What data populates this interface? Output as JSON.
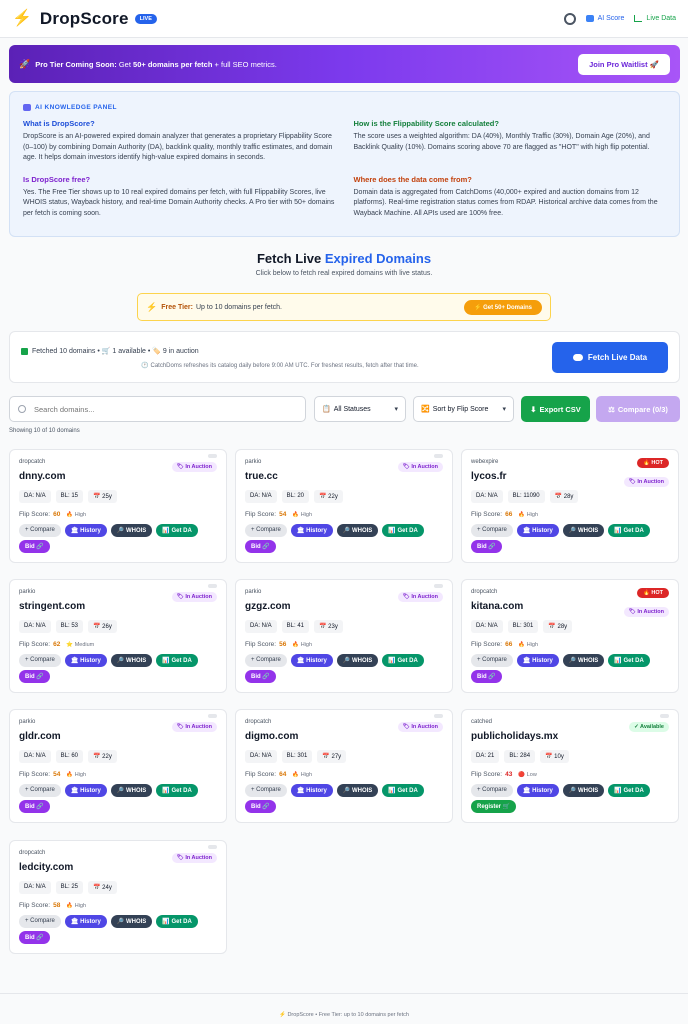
{
  "header": {
    "logo": "DropScore",
    "live_badge": "LIVE",
    "ai_score": "AI Score",
    "live_data": "Live Data"
  },
  "promo": {
    "title": "Pro Tier Coming Soon:",
    "text_pre": "Get",
    "text_bold": "50+ domains per fetch",
    "text_post": "+ full SEO metrics.",
    "button": "Join Pro Waitlist 🚀"
  },
  "knowledge": {
    "title": "AI KNOWLEDGE PANEL",
    "q1": "What is DropScore?",
    "a1": "DropScore is an AI-powered expired domain analyzer that generates a proprietary Flippability Score (0–100) by combining Domain Authority (DA), backlink quality, monthly traffic estimates, and domain age. It helps domain investors identify high-value expired domains in seconds.",
    "q2": "How is the Flippability Score calculated?",
    "a2": "The score uses a weighted algorithm: DA (40%), Monthly Traffic (30%), Domain Age (20%), and Backlink Quality (10%). Domains scoring above 70 are flagged as \"HOT\" with high flip potential.",
    "q3": "Is DropScore free?",
    "a3": "Yes. The Free Tier shows up to 10 real expired domains per fetch, with full Flippability Scores, live WHOIS status, Wayback history, and real-time Domain Authority checks. A Pro tier with 50+ domains per fetch is coming soon.",
    "q4": "Where does the data come from?",
    "a4": "Domain data is aggregated from CatchDoms (40,000+ expired and auction domains from 12 platforms). Real-time registration status comes from RDAP. Historical archive data comes from the Wayback Machine. All APIs used are 100% free."
  },
  "fetch": {
    "title_main": "Fetch Live",
    "title_accent": "Expired Domains",
    "subtitle": "Click below to fetch real expired domains with live status.",
    "free_label": "Free Tier:",
    "free_text": "Up to 10 domains per fetch.",
    "free_btn": "⚡ Get 50+ Domains",
    "stats": "Fetched 10 domains • 🛒 1 available • 🏷️ 9 in auction",
    "note": "🕐 CatchDoms refreshes its catalog daily before 9:00 AM UTC. For freshest results, fetch after that time.",
    "button": "Fetch Live Data"
  },
  "controls": {
    "search_placeholder": "Search domains...",
    "status_select": "All Statuses",
    "sort_select": "Sort by Flip Score",
    "export": "Export CSV",
    "compare": "Compare (0/3)",
    "showing": "Showing 10 of 10 domains"
  },
  "labels": {
    "compare": "+ Compare",
    "history": "History",
    "whois": "🔎 WHOIS",
    "get_da": "Get DA",
    "bid": "Bid 🔗",
    "register": "Register 🛒",
    "flip": "Flip Score:",
    "hot": "🔥 HOT"
  },
  "domains": [
    {
      "registrar": "dropcatch",
      "name": "dnny.com",
      "status": "In Auction",
      "da": "DA: N/A",
      "bl": "BL: 15",
      "age": "25y",
      "score": "60",
      "level": "High"
    },
    {
      "registrar": "parkio",
      "name": "true.cc",
      "status": "In Auction",
      "da": "DA: N/A",
      "bl": "BL: 20",
      "age": "22y",
      "score": "54",
      "level": "High"
    },
    {
      "registrar": "webexpire",
      "name": "lycos.fr",
      "status": "In Auction",
      "da": "DA: N/A",
      "bl": "BL: 11090",
      "age": "28y",
      "score": "66",
      "level": "High"
    },
    {
      "registrar": "parkio",
      "name": "stringent.com",
      "status": "In Auction",
      "da": "DA: N/A",
      "bl": "BL: 53",
      "age": "26y",
      "score": "62",
      "level": "Medium"
    },
    {
      "registrar": "parkio",
      "name": "gzgz.com",
      "status": "In Auction",
      "da": "DA: N/A",
      "bl": "BL: 41",
      "age": "23y",
      "score": "56",
      "level": "High"
    },
    {
      "registrar": "dropcatch",
      "name": "kitana.com",
      "status": "In Auction",
      "da": "DA: N/A",
      "bl": "BL: 301",
      "age": "28y",
      "score": "66",
      "level": "High"
    },
    {
      "registrar": "parkio",
      "name": "gldr.com",
      "status": "In Auction",
      "da": "DA: N/A",
      "bl": "BL: 60",
      "age": "22y",
      "score": "54",
      "level": "High"
    },
    {
      "registrar": "dropcatch",
      "name": "digmo.com",
      "status": "In Auction",
      "da": "DA: N/A",
      "bl": "BL: 301",
      "age": "27y",
      "score": "64",
      "level": "High"
    },
    {
      "registrar": "catched",
      "name": "publicholidays.mx",
      "status": "Available",
      "da": "DA: 21",
      "bl": "BL: 284",
      "age": "10y",
      "score": "43",
      "level": "Low"
    },
    {
      "registrar": "dropcatch",
      "name": "ledcity.com",
      "status": "In Auction",
      "da": "DA: N/A",
      "bl": "BL: 25",
      "age": "24y",
      "score": "58",
      "level": "High"
    }
  ],
  "footer": "⚡ DropScore • Free Tier: up to 10 domains per fetch",
  "colors": {
    "accent": "#2563eb",
    "promo_from": "#5b21b6",
    "promo_to": "#a855f7",
    "hot": "#dc2626"
  }
}
